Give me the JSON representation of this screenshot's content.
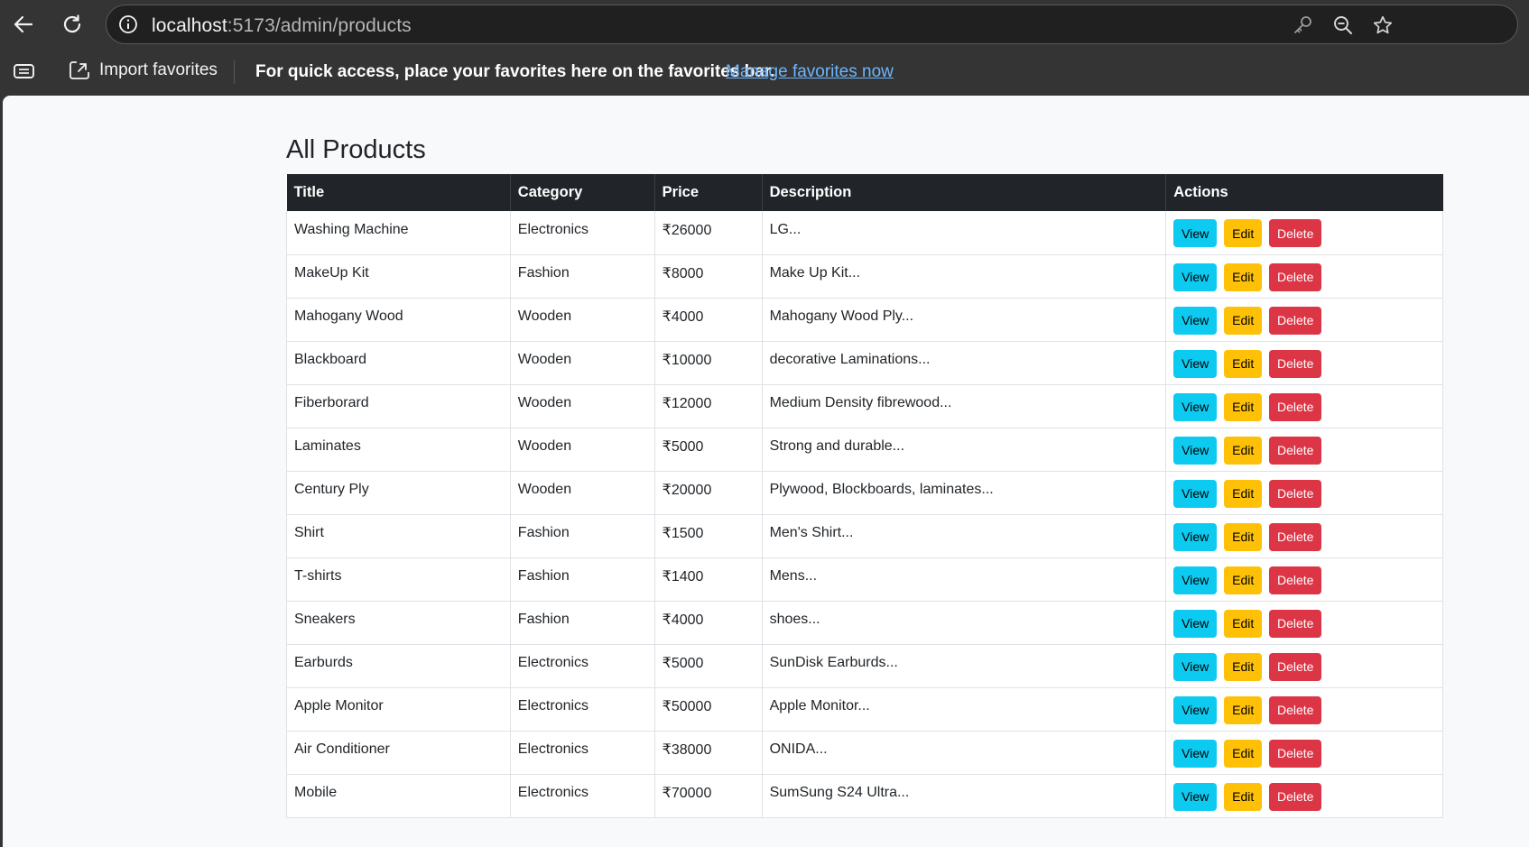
{
  "browser": {
    "url_host": "localhost",
    "url_path": ":5173/admin/products",
    "favorites_bar": {
      "import_label": "Import favorites",
      "message": "For quick access, place your favorites here on the favorites bar.",
      "manage_link": "Manage favorites now"
    },
    "icons": {
      "back": "back-arrow-icon",
      "refresh": "refresh-icon",
      "site_info": "info-icon",
      "password": "key-icon",
      "zoom": "zoom-out-icon",
      "favorite": "star-icon",
      "collections": "collections-icon",
      "import": "import-favorites-icon"
    }
  },
  "page": {
    "title": "All Products",
    "columns": [
      "Title",
      "Category",
      "Price",
      "Description",
      "Actions"
    ],
    "action_labels": {
      "view": "View",
      "edit": "Edit",
      "delete": "Delete"
    },
    "products": [
      {
        "title": "Washing Machine",
        "category": "Electronics",
        "price": "₹26000",
        "description": "LG..."
      },
      {
        "title": "MakeUp Kit",
        "category": "Fashion",
        "price": "₹8000",
        "description": "Make Up Kit..."
      },
      {
        "title": "Mahogany Wood",
        "category": "Wooden",
        "price": "₹4000",
        "description": "Mahogany Wood Ply..."
      },
      {
        "title": "Blackboard",
        "category": "Wooden",
        "price": "₹10000",
        "description": "decorative Laminations..."
      },
      {
        "title": "Fiberborard",
        "category": "Wooden",
        "price": "₹12000",
        "description": "Medium Density fibrewood..."
      },
      {
        "title": "Laminates",
        "category": "Wooden",
        "price": "₹5000",
        "description": "Strong and durable..."
      },
      {
        "title": "Century Ply",
        "category": "Wooden",
        "price": "₹20000",
        "description": "Plywood, Blockboards, laminates..."
      },
      {
        "title": "Shirt",
        "category": "Fashion",
        "price": "₹1500",
        "description": "Men's Shirt..."
      },
      {
        "title": "T-shirts",
        "category": "Fashion",
        "price": "₹1400",
        "description": "Mens..."
      },
      {
        "title": "Sneakers",
        "category": "Fashion",
        "price": "₹4000",
        "description": "shoes..."
      },
      {
        "title": "Earburds",
        "category": "Electronics",
        "price": "₹5000",
        "description": "SunDisk Earburds..."
      },
      {
        "title": "Apple Monitor",
        "category": "Electronics",
        "price": "₹50000",
        "description": "Apple Monitor..."
      },
      {
        "title": "Air Conditioner",
        "category": "Electronics",
        "price": "₹38000",
        "description": "ONIDA..."
      },
      {
        "title": "Mobile",
        "category": "Electronics",
        "price": "₹70000",
        "description": "SumSung S24 Ultra..."
      }
    ]
  },
  "colors": {
    "table_header": "#212529",
    "view_button": "#0dcaf0",
    "edit_button": "#ffc107",
    "delete_button": "#dc3545",
    "link": "#6cb6ff"
  }
}
